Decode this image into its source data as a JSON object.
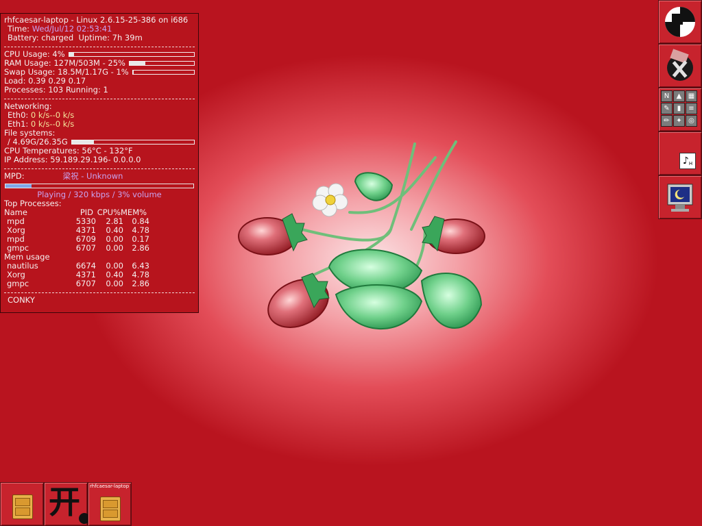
{
  "conky": {
    "header": "rhfcaesar-laptop - Linux 2.6.15-25-386 on i686",
    "time_label": "Time:",
    "time_value": "Wed/Jul/12 02:53:41",
    "battery_label": "Battery:",
    "battery_value": "charged",
    "uptime_label": "Uptime:",
    "uptime_value": "7h 39m",
    "cpu_usage": "CPU Usage: 4%",
    "cpu_percent": 4,
    "ram_usage": "RAM Usage: 127M/503M - 25%",
    "ram_percent": 25,
    "swap_usage": "Swap Usage: 18.5M/1.17G - 1%",
    "swap_percent": 1,
    "load": "Load: 0.39 0.29 0.17",
    "processes": "Processes: 103  Running: 1",
    "networking_label": "Networking:",
    "eth0_label": "Eth0:",
    "eth0_value": "0 k/s--0 k/s",
    "eth1_label": "Eth1:",
    "eth1_value": "0 k/s--0 k/s",
    "filesystems_label": "File systems:",
    "fs_root": "/ 4.69G/26.35G",
    "fs_percent": 18,
    "cpu_temp": "CPU Temperatures: 56°C - 132°F",
    "ip_address": "IP Address: 59.189.29.196- 0.0.0.0",
    "mpd_label": "MPD:",
    "mpd_song": "梁祝 - Unknown",
    "mpd_progress_percent": 14,
    "mpd_status": "Playing / 320 kbps / 3% volume",
    "top_processes_label": "Top Processes:",
    "table_header": [
      "Name",
      "PID",
      "CPU%",
      "MEM%"
    ],
    "top_processes": [
      [
        "mpd",
        "5330",
        "2.81",
        "0.84"
      ],
      [
        "Xorg",
        "4371",
        "0.40",
        "4.78"
      ],
      [
        "mpd",
        "6709",
        "0.00",
        "0.17"
      ],
      [
        "gmpc",
        "6707",
        "0.00",
        "2.86"
      ]
    ],
    "mem_usage_label": "Mem usage",
    "mem_processes": [
      [
        "nautilus",
        "6674",
        "0.00",
        "6.43"
      ],
      [
        "Xorg",
        "4371",
        "0.40",
        "4.78"
      ],
      [
        "gmpc",
        "6707",
        "0.00",
        "2.86"
      ]
    ],
    "footer": "CONKY"
  },
  "dock": {
    "mixer_glyph": "♪",
    "mixer_sub": "H",
    "launcher_glyphs": [
      "N",
      "▲",
      "▦",
      "✎",
      "▮",
      "≡",
      "✏",
      "✦",
      "◎"
    ]
  },
  "tiles": {
    "window_title_snippet": "rhfcaesar-laptop"
  }
}
